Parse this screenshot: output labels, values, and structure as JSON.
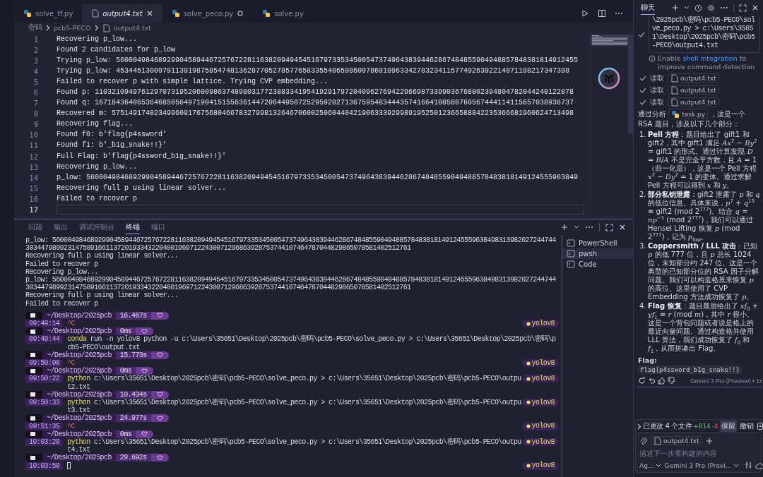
{
  "editor": {
    "tabs": [
      {
        "label": "solve_tf.py",
        "kind": "python",
        "selected": false,
        "modified": false
      },
      {
        "label": "output4.txt",
        "kind": "text",
        "selected": true,
        "modified": false
      },
      {
        "label": "solve_peco.py",
        "kind": "python",
        "selected": false,
        "modified": true
      },
      {
        "label": "solve.py",
        "kind": "python",
        "selected": false,
        "modified": false
      }
    ],
    "breadcrumb": [
      "密码",
      "pcb5-PECO",
      "output4.txt"
    ],
    "lines": [
      {
        "number": "1",
        "text": "Recovering p_low...",
        "current": false
      },
      {
        "number": "2",
        "text": "Found 2 candidates for p_low",
        "current": false
      },
      {
        "number": "3",
        "text": "Trying p_low: 5600049846892990458944672576722811638209494545167973353450054737496438394462867484855904948857848381814912455",
        "current": false
      },
      {
        "number": "4",
        "text": "Trying p_low: 45344513009791139198758547481362877052785776583355406598609786910963342783234115774926392214871198217347398",
        "current": false
      },
      {
        "number": "5",
        "text": "Failed to recover p with simple lattice. Trying CVP embedding...",
        "current": false
      },
      {
        "number": "6",
        "text": "Found p: 11032109497612970731952060098637489803177238833419541929179720409627694229669873399036768002394804782044240122878",
        "current": false
      },
      {
        "number": "7",
        "text": "Found q: 16718436406536468505649719041515563614472064495072529592027136759548344435741664108580760567444114115657038936737",
        "current": false
      },
      {
        "number": "8",
        "text": "Recovered m: 5751491740234996091767568046678327998132646706002506044042190633392998919525012366588842235366681960624713498",
        "current": false
      },
      {
        "number": "9",
        "text": "Recovering flag...",
        "current": false
      },
      {
        "number": "10",
        "text": "Found f0: b'flag{p4ssword'",
        "current": false
      },
      {
        "number": "11",
        "text": "Found f1: b'_b1g_snake!!}'",
        "current": false
      },
      {
        "number": "12",
        "text": "Full Flag: b'flag{p4ssword_b1g_snake!!}'",
        "current": false
      },
      {
        "number": "13",
        "text": "Recovering p_low...",
        "current": false
      },
      {
        "number": "14",
        "text": "p_low: 56000498468929904589446725767228116382094945451679733534500547374964383944628674848559049488578483818149124555963849",
        "current": false
      },
      {
        "number": "15",
        "text": "Recovering full p using linear solver...",
        "current": false
      },
      {
        "number": "16",
        "text": "Failed to recover p",
        "current": false
      },
      {
        "number": "17",
        "current": true
      }
    ]
  },
  "panel": {
    "tabs": [
      {
        "label": "问题",
        "selected": false
      },
      {
        "label": "输出",
        "selected": false
      },
      {
        "label": "调试控制台",
        "selected": false
      },
      {
        "label": "终端",
        "selected": true
      },
      {
        "label": "端口",
        "selected": false
      }
    ],
    "terminal": {
      "lines": [
        "p_low: 56000498468929904589446725767228116382094945451679733534500547374964383944628674848559049488578483818149124555963849831398202724474430344798992314758916611372019334322040019697122430071296863928753744107464787044829865078581402512761",
        "Recovering full p using linear solver...",
        "Failed to recover p",
        "Recovering p_low...",
        "p_low: 56000498468929904589446725767228116382094945451679733534500547374964383944628674848559049488578483818149124555963849831398202724474430344798992314758916611372019334322040019697122430071296863928753744107464787044829865078581402512761",
        "Recovering full p using linear solver...",
        "Failed to recover p"
      ],
      "prompts": [
        {
          "path": "~/Desktop/2025pcb",
          "duration": "16.467s",
          "time": "09:49:14",
          "kind": "interrupt",
          "command": "^C",
          "env": "yolov8"
        },
        {
          "path": "~/Desktop/2025pcb",
          "duration": "0ms",
          "time": "09:49:44",
          "kind": "command",
          "program": "conda",
          "command": "run -n yolov8 python -u c:\\Users\\35651\\Desktop\\2025pcb\\密码\\pcb5-PECO\\solve_peco.py > c:\\Users\\35651\\Desktop\\2025pcb\\密码\\pcb5-PECO\\output.txt"
        },
        {
          "path": "~/Desktop/2025pcb",
          "duration": "15.773s",
          "time": "09:50:00",
          "kind": "interrupt",
          "command": "^C",
          "env": "yolov8"
        },
        {
          "path": "~/Desktop/2025pcb",
          "duration": "0ms",
          "time": "09:50:22",
          "kind": "command",
          "program": "python",
          "command": "c:\\Users\\35651\\Desktop\\2025pcb\\密码\\pcb5-PECO\\solve_peco.py > c:\\Users\\35651\\Desktop\\2025pcb\\密码\\pcb5-PECO\\output2.txt",
          "env": "yolov8"
        },
        {
          "path": "~/Desktop/2025pcb",
          "duration": "10.434s",
          "time": "09:50:33",
          "kind": "command",
          "program": "python",
          "command": "c:\\Users\\35651\\Desktop\\2025pcb\\密码\\pcb5-PECO\\solve_peco.py > c:\\Users\\35651\\Desktop\\2025pcb\\密码\\pcb5-PECO\\output3.txt",
          "env": "yolov8"
        },
        {
          "path": "~/Desktop/2025pcb",
          "duration": "24.977s",
          "time": "09:51:35",
          "kind": "interrupt",
          "command": "^C",
          "env": "yolov8"
        },
        {
          "path": "~/Desktop/2025pcb",
          "duration": "0ms",
          "time": "10:03:20",
          "kind": "command",
          "program": "python",
          "command": "c:\\Users\\35651\\Desktop\\2025pcb\\密码\\pcb5-PECO\\solve_peco.py > c:\\Users\\35651\\Desktop\\2025pcb\\密码\\pcb5-PECO\\output4.txt",
          "env": "yolov8"
        },
        {
          "path": "~/Desktop/2025pcb",
          "duration": "29.692s",
          "time": "10:03:50",
          "kind": "cursor",
          "env": "yolov8"
        }
      ]
    },
    "shells": [
      {
        "label": "PowerShell",
        "selected": false
      },
      {
        "label": "pwsh",
        "selected": true
      },
      {
        "label": "Code",
        "selected": false
      }
    ]
  },
  "chat": {
    "tab": {
      "label": "聊天",
      "selected": true
    },
    "command_block": "\\2025pcb\\密码\\pcb5-PECO\\solve_peco.py > c:\\Users\\35651\\Desktop\\2025pcb\\密码\\pcb5-PECO\\output4.txt",
    "notice": {
      "before": "Enable",
      "link": "shell integration",
      "after": "to improve command detection"
    },
    "reads": [
      {
        "verb": "读取",
        "file": "output4.txt"
      },
      {
        "verb": "读取",
        "file": "output4.txt"
      },
      {
        "verb": "读取",
        "file": "output4.txt"
      }
    ],
    "intro": {
      "before": "通过分析",
      "file": "task.py",
      "after": "，这是一个 RSA 题目，涉及以下几个部分："
    },
    "points": [
      {
        "number": "1.",
        "text": "**Pell 方程**：题目给出了 gift1 和 gift2，其中 gift1 满足 *Ax*$^{2}$ − *By*$^{2}$ = gift1 的形式。通过计算发现 *D* = *B*/*A* 不是完全平方数，且 *A* = 1（归一化后），这是一个 Pell 方程 *x*$^{2}$ − *Dy*$^{2}$ = 1 的变体。通过求解 Pell 方程可以得到 *x* 和 *y*。"
      },
      {
        "number": "2.",
        "text": "**部分私钥泄露**：gift2 泄露了 *p* 和 *q* 的低位信息。具体来说，*p*$^{7}$ + *q*$^{13}$ ≡ gift2 (mod 2$^{777}$)。结合 *q* = *np*$^{−1}$ (mod 2$^{777}$)，我们可以通过 Hensel Lifting 恢复 *p* (mod 2$^{777}$)，记为 *p*$_{low}$。"
      },
      {
        "number": "3.",
        "text": "**Coppersmith / LLL 攻击**：已知 *p* 的低 777 位，且 *p* 总长 1024 位，未知部分约 247 位。这是一个典型的已知部分位的 RSA 因子分解问题。我们可以构造格基来恢复 *p* 的高位。这里使用了 CVP Embedding 方法成功恢复了 *p*。"
      },
      {
        "number": "4.",
        "text": "**Flag 恢复**：题目最后给出了 *xf*$_{0}$ + *yf*$_{1}$ ≡ *r* (mod *m*)，其中 *r* 很小。这是一个背包问题或者说是格上的最近向量问题。通过构造格并使用 LLL 算法，我们成功恢复了 *f*$_{0}$ 和 *f*$_{1}$，从而拼凑出 Flag。"
      }
    ],
    "flag_label": "Flag:",
    "flag_code": "flag{p4ssword_b1g_snake!!}",
    "model_note": "Gemini 3 Pro (Preview) • 1x",
    "changes": {
      "summary": "已更改 4 个文件",
      "added": "+814",
      "removed": "-4",
      "keep": "保留",
      "undo": "撤销"
    },
    "input": {
      "attachment": "output4.txt",
      "placeholder": "描述下一步要构建的内容",
      "mode": "Ag...",
      "model": "Gemini 3 Pro (Previ..."
    }
  }
}
